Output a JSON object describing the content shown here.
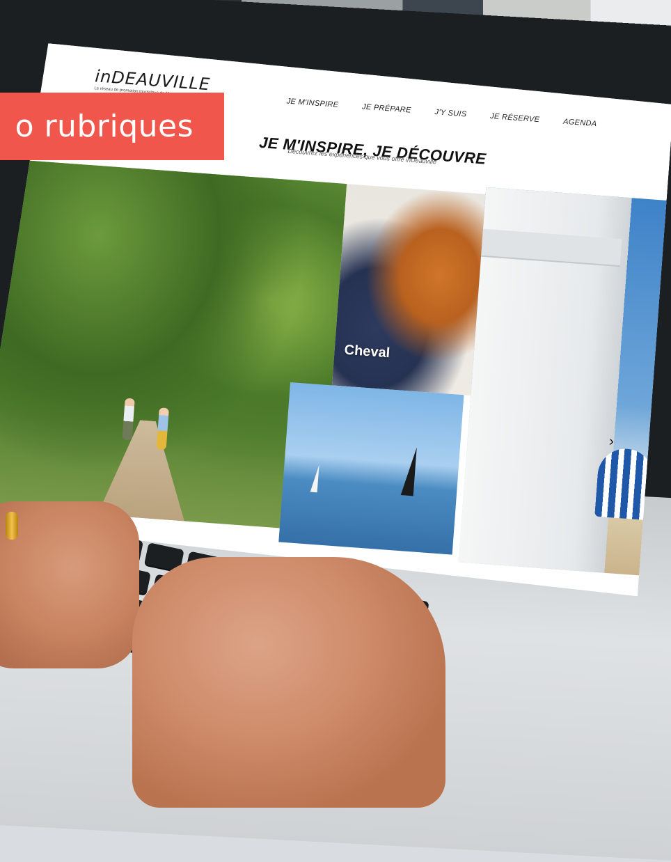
{
  "banner": {
    "text": "o rubriques"
  },
  "site": {
    "logo": {
      "name": "inDEAUVILLE",
      "tagline": "Le réseau de promotion touristique de 11 communes"
    },
    "nav": [
      {
        "label": "JE M'INSPIRE"
      },
      {
        "label": "JE PRÉPARE"
      },
      {
        "label": "J'Y SUIS"
      },
      {
        "label": "JE RÉSERVE"
      },
      {
        "label": "AGENDA"
      }
    ],
    "hero": {
      "title": "JE M'INSPIRE, JE DÉCOUVRE",
      "subtitle": "Découvrez les expériences que vous offre inDeauville"
    },
    "gallery": {
      "tiles": [
        {
          "label": ""
        },
        {
          "label": "Cheval"
        },
        {
          "label": ""
        },
        {
          "label": ""
        }
      ],
      "prev_icon": "chevron-left-icon",
      "next_icon": "chevron-right-icon"
    }
  },
  "colors": {
    "banner": "#f0564b",
    "text": "#111111"
  }
}
